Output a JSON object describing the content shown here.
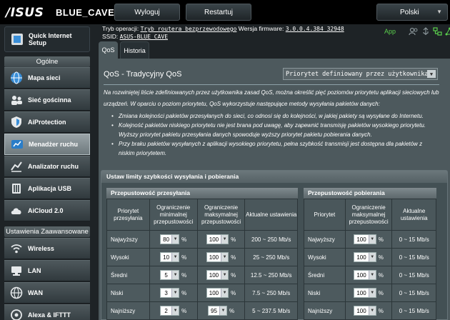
{
  "header": {
    "logo": "/ISUS",
    "model": "BLUE_CAVE",
    "logout": "Wyloguj",
    "restart": "Restartuj",
    "language": "Polski"
  },
  "info": {
    "mode_label": "Tryb operacji:",
    "mode_value": "Tryb routera bezprzewodowego",
    "firmware_label": "Wersja firmware:",
    "firmware_value": "3.0.0.4.384_32948",
    "ssid_label": "SSID:",
    "ssid_value": "ASUS-BLUE_CAVE",
    "app_label": "App"
  },
  "sidebar": {
    "quick": "Quick Internet Setup",
    "group_general": "Ogólne",
    "items": [
      {
        "label": "Mapa sieci"
      },
      {
        "label": "Sieć gościnna"
      },
      {
        "label": "AiProtection"
      },
      {
        "label": "Menadżer ruchu"
      },
      {
        "label": "Analizator ruchu"
      },
      {
        "label": "Aplikacja USB"
      },
      {
        "label": "AiCloud 2.0"
      }
    ],
    "group_advanced": "Ustawienia Zaawansowane",
    "adv_items": [
      {
        "label": "Wireless"
      },
      {
        "label": "LAN"
      },
      {
        "label": "WAN"
      },
      {
        "label": "Alexa & IFTTT"
      }
    ]
  },
  "tabs": {
    "qos": "QoS",
    "history": "Historia"
  },
  "panel": {
    "title": "QoS - Tradycyjny QoS",
    "mode_selected": "Priorytet definiowany przez użytkownika",
    "description": "Na rozwiniętej liście zdefiniowanych przez użytkownika zasad QoS, można określić pięć poziomów priorytetu aplikacji sieciowych lub urządzeń. W oparciu o poziom priorytetu, QoS wykorzystuje następujące metody wysyłania pakietów danych:",
    "bullets": [
      "Zmiana kolejności pakietów przesyłanych do sieci, co odnosi się do kolejności, w jakiej pakiety są wysyłane do Internetu.",
      "Kolejność pakietów niskiego priorytetu nie jest brana pod uwagę, aby zapewnić transmisję pakietów wysokiego priorytetu. Wyższy priorytet pakietu przesyłania danych spowoduje wyższy priorytet pakietu pobierania danych.",
      "Przy braku pakietów wysyłanych z aplikacji wysokiego priorytetu, pełna szybkość transmisji jest dostępna dla pakietów z niskim priorytetem."
    ]
  },
  "limits": {
    "title": "Ustaw limity szybkości wysyłania i pobierania",
    "upload": {
      "title": "Przepustowość przesyłania",
      "headers": [
        "Priorytet przesyłania",
        "Ograniczenie minimalnej przepustowości",
        "Ograniczenie maksymalnej przepustowości",
        "Aktualne ustawienia"
      ],
      "rows": [
        {
          "name": "Najwyższy",
          "min": "80",
          "max": "100",
          "rate": "200 ~ 250 Mb/s"
        },
        {
          "name": "Wysoki",
          "min": "10",
          "max": "100",
          "rate": "25 ~ 250 Mb/s"
        },
        {
          "name": "Średni",
          "min": "5",
          "max": "100",
          "rate": "12.5 ~ 250 Mb/s"
        },
        {
          "name": "Niski",
          "min": "3",
          "max": "100",
          "rate": "7.5 ~ 250 Mb/s"
        },
        {
          "name": "Najniższy",
          "min": "2",
          "max": "95",
          "rate": "5 ~ 237.5 Mb/s"
        }
      ]
    },
    "download": {
      "title": "Przepustowość pobierania",
      "headers": [
        "Priorytet",
        "Ograniczenie maksymalnej przepustowości",
        "Aktualne ustawienia"
      ],
      "rows": [
        {
          "name": "Najwyższy",
          "max": "100",
          "rate": "0 ~ 15 Mb/s"
        },
        {
          "name": "Wysoki",
          "max": "100",
          "rate": "0 ~ 15 Mb/s"
        },
        {
          "name": "Średni",
          "max": "100",
          "rate": "0 ~ 15 Mb/s"
        },
        {
          "name": "Niski",
          "max": "100",
          "rate": "0 ~ 15 Mb/s"
        },
        {
          "name": "Najniższy",
          "max": "100",
          "rate": "0 ~ 15 Mb/s"
        }
      ]
    },
    "percent": "%"
  },
  "colors": {
    "accent_green": "#5bd04d",
    "panel": "#4d595d",
    "topbar": "#000000"
  }
}
